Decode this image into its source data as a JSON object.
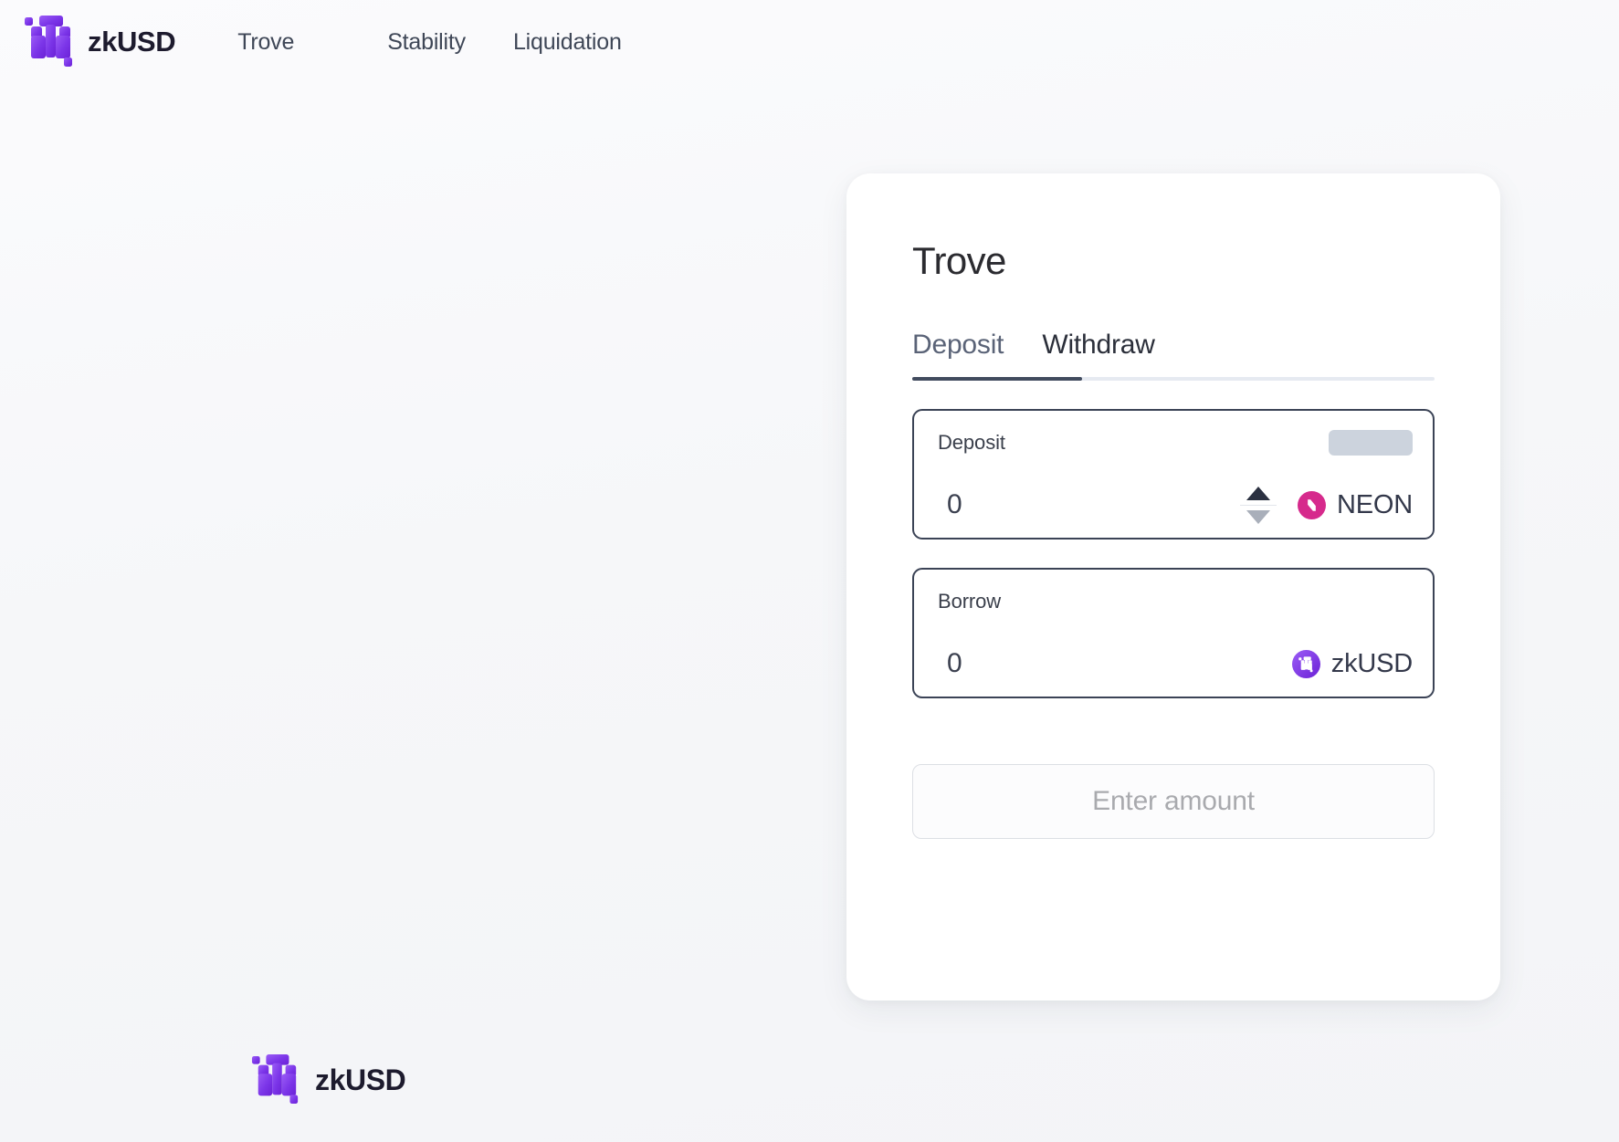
{
  "header": {
    "logo_icon": "zkusd-pixel-t-logo",
    "brand": "zkUSD",
    "nav": [
      {
        "label": "Trove"
      },
      {
        "label": "Stability"
      },
      {
        "label": "Liquidation"
      }
    ]
  },
  "card": {
    "title": "Trove",
    "tabs": [
      {
        "label": "Deposit",
        "active": true
      },
      {
        "label": "Withdraw",
        "active": false
      }
    ],
    "fields": [
      {
        "label": "Deposit",
        "value": "0",
        "token": "NEON",
        "token_icon": "neon-token-icon",
        "has_spinner": true,
        "has_skeleton": true
      },
      {
        "label": "Borrow",
        "value": "0",
        "token": "zkUSD",
        "token_icon": "zkusd-token-icon",
        "has_spinner": false,
        "has_skeleton": false
      }
    ],
    "action_button": {
      "label": "Enter amount",
      "disabled": true
    }
  },
  "footer": {
    "logo_icon": "zkusd-pixel-t-logo",
    "brand": "zkUSD"
  },
  "colors": {
    "background": "#f7f8fa",
    "card_background": "#ffffff",
    "brand_purple": "#7B35E8",
    "neon_pink": "#D62A8C",
    "tab_active_underline": "#414b5e",
    "tab_track": "#e6eaf1",
    "field_border": "#3b4356",
    "skeleton": "#ccd3dd",
    "text_dark": "#2e3440",
    "text_muted": "#a9aaae"
  }
}
